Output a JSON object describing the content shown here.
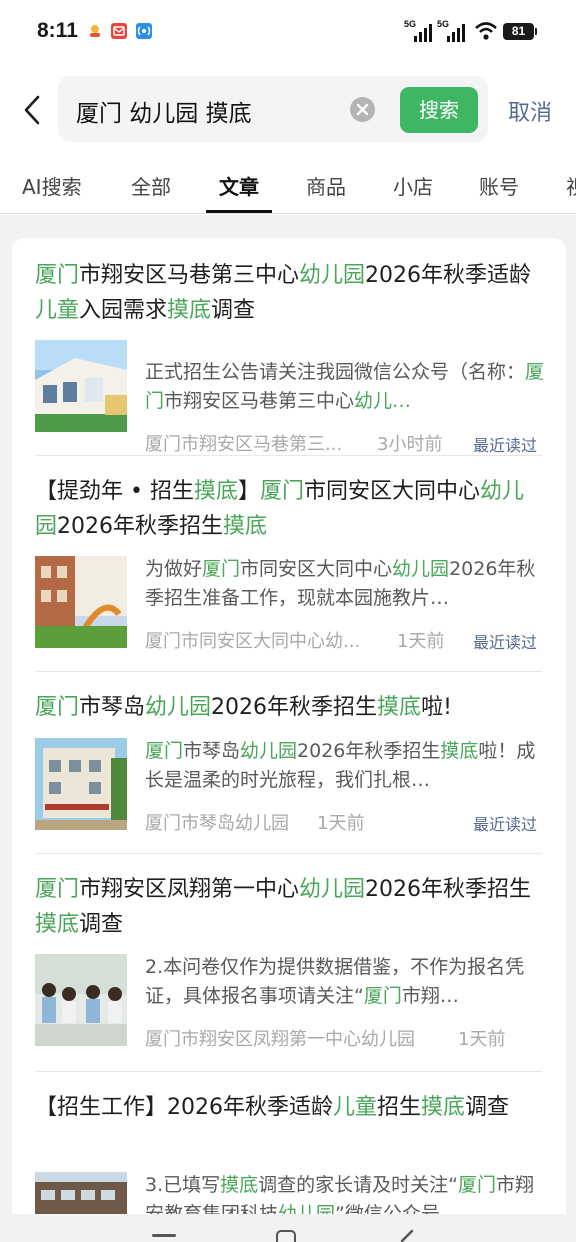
{
  "status": {
    "time": "8:11",
    "sim1": "5G",
    "sim2": "5G",
    "battery": "81"
  },
  "search": {
    "query": "厦门 幼儿园 摸底",
    "button": "搜索",
    "cancel": "取消"
  },
  "tabs": [
    {
      "label": "AI搜索",
      "active": false
    },
    {
      "label": "全部",
      "active": false
    },
    {
      "label": "文章",
      "active": true
    },
    {
      "label": "商品",
      "active": false
    },
    {
      "label": "小店",
      "active": false
    },
    {
      "label": "账号",
      "active": false
    },
    {
      "label": "视",
      "active": false
    }
  ],
  "colors": {
    "highlight": "#4aa659",
    "accent_green": "#3fb663",
    "link_blue": "#576b95"
  },
  "results": [
    {
      "title_segments": [
        {
          "t": "厦门",
          "hl": true
        },
        {
          "t": "市翔安区马巷第三中心",
          "hl": false
        },
        {
          "t": "幼儿园",
          "hl": true
        },
        {
          "t": "2026年秋季适龄",
          "hl": false
        },
        {
          "t": "儿童",
          "hl": true
        },
        {
          "t": "入园需求",
          "hl": false
        },
        {
          "t": "摸底",
          "hl": true
        },
        {
          "t": "调查",
          "hl": false
        }
      ],
      "summary_segments": [
        {
          "t": "正式招生公告请关注我园微信公众号（名称：",
          "hl": false
        },
        {
          "t": "厦门",
          "hl": true
        },
        {
          "t": "市翔安区马巷第三中心",
          "hl": false
        },
        {
          "t": "幼儿…",
          "hl": true
        }
      ],
      "source": "厦门市翔安区马巷第三...",
      "time": "3小时前",
      "read_label": "最近读过",
      "thumb": "kindergarten-building-photo"
    },
    {
      "title_segments": [
        {
          "t": "【提劲年 • 招生",
          "hl": false
        },
        {
          "t": "摸底",
          "hl": true
        },
        {
          "t": "】",
          "hl": false
        },
        {
          "t": "厦门",
          "hl": true
        },
        {
          "t": "市同安区大同中心",
          "hl": false
        },
        {
          "t": "幼儿园",
          "hl": true
        },
        {
          "t": "2026年秋季招生",
          "hl": false
        },
        {
          "t": "摸底",
          "hl": true
        }
      ],
      "summary_segments": [
        {
          "t": "为做好",
          "hl": false
        },
        {
          "t": "厦门",
          "hl": true
        },
        {
          "t": "市同安区大同中心",
          "hl": false
        },
        {
          "t": "幼儿园",
          "hl": true
        },
        {
          "t": "2026年秋季招生准备工作，现就本园施教片…",
          "hl": false
        }
      ],
      "source": "厦门市同安区大同中心幼...",
      "time": "1天前",
      "read_label": "最近读过",
      "thumb": "playground-slide-photo"
    },
    {
      "title_segments": [
        {
          "t": "厦门",
          "hl": true
        },
        {
          "t": "市琴岛",
          "hl": false
        },
        {
          "t": "幼儿园",
          "hl": true
        },
        {
          "t": "2026年秋季招生",
          "hl": false
        },
        {
          "t": "摸底",
          "hl": true
        },
        {
          "t": "啦!",
          "hl": false
        }
      ],
      "summary_segments": [
        {
          "t": "厦门",
          "hl": true
        },
        {
          "t": "市琴岛",
          "hl": false
        },
        {
          "t": "幼儿园",
          "hl": true
        },
        {
          "t": "2026年秋季招生",
          "hl": false
        },
        {
          "t": "摸底",
          "hl": true
        },
        {
          "t": "啦！成长是温柔的时光旅程，我们扎根…",
          "hl": false
        }
      ],
      "source": "厦门市琴岛幼儿园",
      "time": "1天前",
      "read_label": "最近读过",
      "thumb": "school-building-photo"
    },
    {
      "title_segments": [
        {
          "t": "厦门",
          "hl": true
        },
        {
          "t": "市翔安区凤翔第一中心",
          "hl": false
        },
        {
          "t": "幼儿园",
          "hl": true
        },
        {
          "t": "2026年秋季招生",
          "hl": false
        },
        {
          "t": "摸底",
          "hl": true
        },
        {
          "t": "调查",
          "hl": false
        }
      ],
      "summary_segments": [
        {
          "t": "2.本问卷仅作为提供数据借鉴，不作为报名凭证，具体报名事项请关注“",
          "hl": false
        },
        {
          "t": "厦门",
          "hl": true
        },
        {
          "t": "市翔…",
          "hl": false
        }
      ],
      "source": "厦门市翔安区凤翔第一中心幼儿园",
      "time": "1天前",
      "read_label": "",
      "thumb": "children-group-photo"
    },
    {
      "title_segments": [
        {
          "t": "【招生工作】2026年秋季适龄",
          "hl": false
        },
        {
          "t": "儿童",
          "hl": true
        },
        {
          "t": "招生",
          "hl": false
        },
        {
          "t": "摸底",
          "hl": true
        },
        {
          "t": "调查",
          "hl": false
        }
      ],
      "summary_segments": [
        {
          "t": "3.已填写",
          "hl": false
        },
        {
          "t": "摸底",
          "hl": true
        },
        {
          "t": "调查的家长请及时关注“",
          "hl": false
        },
        {
          "t": "厦门",
          "hl": true
        },
        {
          "t": "市翔安教育集团科技",
          "hl": false
        },
        {
          "t": "幼儿园",
          "hl": true
        },
        {
          "t": "”微信公众号",
          "hl": false
        }
      ],
      "source": "",
      "time": "",
      "read_label": "",
      "thumb": "campus-building-photo"
    }
  ]
}
